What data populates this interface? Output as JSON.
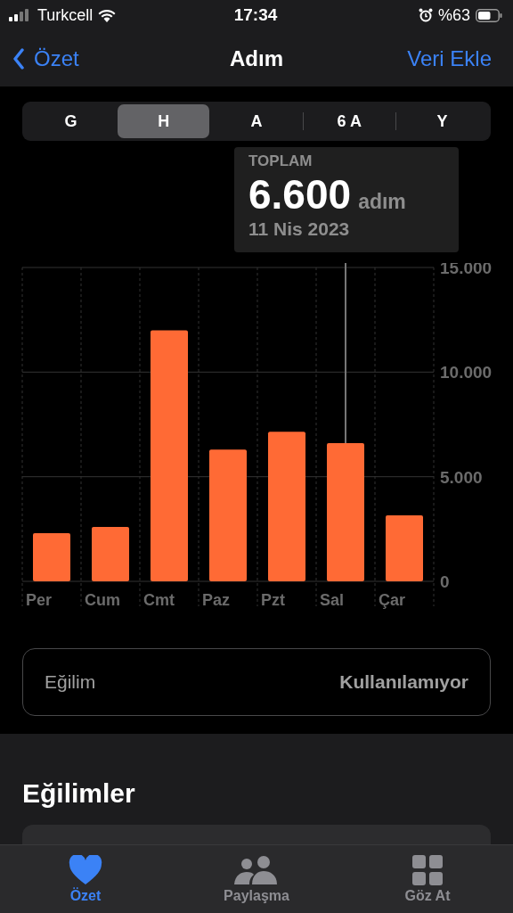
{
  "status_bar": {
    "carrier": "Turkcell",
    "time": "17:34",
    "battery": "%63"
  },
  "nav": {
    "back": "Özet",
    "title": "Adım",
    "action": "Veri Ekle"
  },
  "segments": [
    {
      "label": "G",
      "selected": false
    },
    {
      "label": "H",
      "selected": true
    },
    {
      "label": "A",
      "selected": false
    },
    {
      "label": "6 A",
      "selected": false
    },
    {
      "label": "Y",
      "selected": false
    }
  ],
  "tooltip": {
    "label": "TOPLAM",
    "value": "6.600",
    "unit": "adım",
    "date": "11 Nis 2023"
  },
  "chart_data": {
    "type": "bar",
    "categories": [
      "Per",
      "Cum",
      "Cmt",
      "Paz",
      "Pzt",
      "Sal",
      "Çar"
    ],
    "series": [
      {
        "color": "#ff6a35",
        "values": [
          2300,
          2600,
          12000,
          6300,
          7150,
          6600,
          3150
        ]
      }
    ],
    "ylim": [
      0,
      15000
    ],
    "yticks": [
      {
        "value": 0,
        "label": "0"
      },
      {
        "value": 5000,
        "label": "5.000"
      },
      {
        "value": 10000,
        "label": "10.000"
      },
      {
        "value": 15000,
        "label": "15.000"
      }
    ],
    "annotations": [
      {
        "x": "Sal"
      }
    ]
  },
  "trend": {
    "label": "Eğilim",
    "value": "Kullanılamıyor"
  },
  "section_title": "Eğilimler",
  "tab_bar": [
    {
      "label": "Özet",
      "kind": "heart",
      "selected": true
    },
    {
      "label": "Paylaşma",
      "kind": "people",
      "selected": false
    },
    {
      "label": "Göz At",
      "kind": "grid",
      "selected": false
    }
  ]
}
